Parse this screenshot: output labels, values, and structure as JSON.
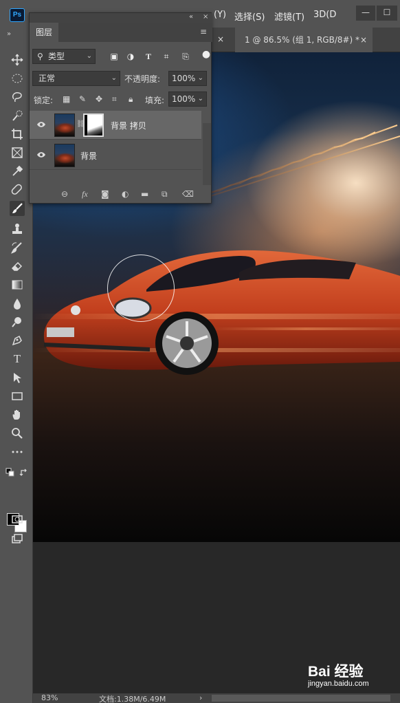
{
  "app": {
    "logo": "Ps"
  },
  "menu": {
    "items": [
      "(Y)",
      "选择(S)",
      "滤镜(T)",
      "3D(D"
    ]
  },
  "window_controls": {
    "minimize": "—",
    "maximize": "☐"
  },
  "tabs": {
    "document": {
      "title": "1 @ 86.5% (组 1, RGB/8#) *",
      "close": "×"
    },
    "previous_close": "×"
  },
  "layers_panel": {
    "title": "图层",
    "collapse": "«",
    "close": "×",
    "menu": "≡",
    "filter": {
      "label": "类型",
      "icons": [
        "image-filter-icon",
        "adjustment-filter-icon",
        "type-filter-icon",
        "shape-filter-icon",
        "smart-object-filter-icon"
      ]
    },
    "blend_mode": "正常",
    "opacity_label": "不透明度:",
    "opacity_value": "100%",
    "lock_label": "锁定:",
    "fill_label": "填充:",
    "fill_value": "100%",
    "layers": [
      {
        "name": "背景 拷贝",
        "visible": true,
        "selected": true,
        "has_mask": true
      },
      {
        "name": "背景",
        "visible": true,
        "selected": false,
        "has_mask": false
      }
    ],
    "footer_icons": [
      "link-icon",
      "fx-icon",
      "add-mask-icon",
      "adjustment-layer-icon",
      "group-folder-icon",
      "new-layer-icon",
      "trash-icon"
    ],
    "fx_label": "fx"
  },
  "toolbar": {
    "collapse": "»",
    "tools": [
      "move",
      "marquee",
      "lasso",
      "quick-select",
      "crop",
      "frame",
      "eyedropper",
      "healing",
      "brush",
      "stamp",
      "history-brush",
      "eraser",
      "gradient",
      "blur",
      "dodge",
      "pen",
      "type",
      "path-select",
      "rectangle",
      "hand",
      "zoom",
      "more",
      "swap-colors",
      "quick-mask",
      "screen-mode"
    ],
    "active_tool": "brush",
    "foreground_color": "#000000",
    "background_color": "#ffffff",
    "type_tool_label": "T"
  },
  "status": {
    "zoom": "83%",
    "doc": "文档:1.38M/6.49M",
    "arrow": "›"
  },
  "watermark": {
    "main": "Bai 经验",
    "sub": "jingyan.baidu.com"
  }
}
